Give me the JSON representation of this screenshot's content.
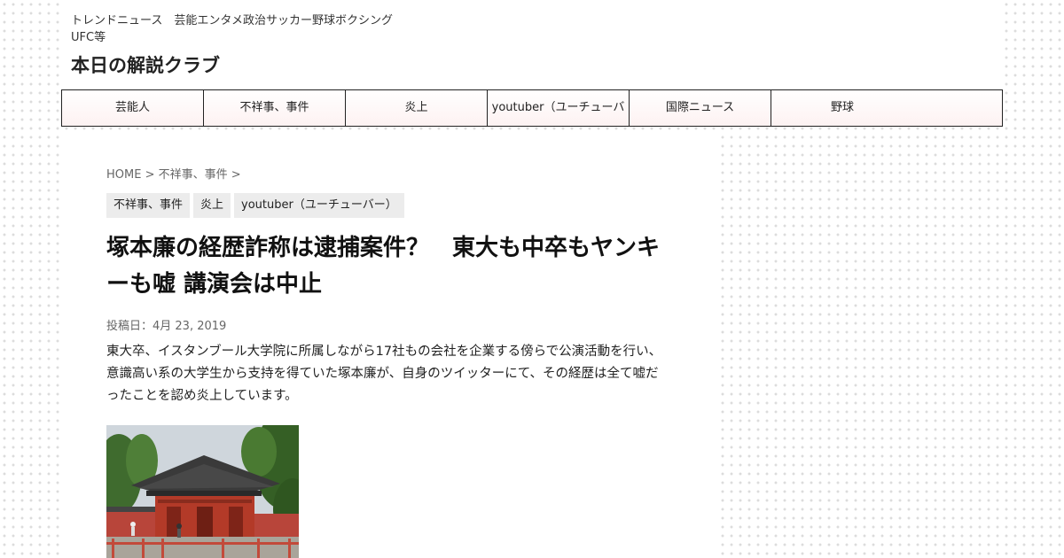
{
  "header": {
    "description": "トレンドニュース　芸能エンタメ政治サッカー野球ボクシングUFC等",
    "site_title": "本日の解説クラブ"
  },
  "nav": {
    "items": [
      {
        "label": "芸能人"
      },
      {
        "label": "不祥事、事件"
      },
      {
        "label": "炎上"
      },
      {
        "label": "youtuber（ユーチューバ"
      },
      {
        "label": "国際ニュース"
      },
      {
        "label": "野球"
      }
    ]
  },
  "breadcrumb": {
    "home": "HOME",
    "sep1": " > ",
    "category": "不祥事、事件",
    "sep2": " >"
  },
  "tags": [
    "不祥事、事件",
    "炎上",
    "youtuber（ユーチューバー）"
  ],
  "article": {
    "title": "塚本廉の経歴詐称は逮捕案件？　東大も中卒もヤンキーも嘘 講演会は中止",
    "date": "投稿日：4月 23, 2019",
    "excerpt": "東大卒、イスタンブール大学院に所属しながら17社もの会社を企業する傍らで公演活動を行い、意識高い系の大学生から支持を得ていた塚本廉が、自身のツイッターにて、その経歴は全て嘘だったことを認め炎上しています。"
  },
  "colors": {
    "nav_gradient_bottom": "#fdf2f2",
    "border": "#222222",
    "tag_bg": "#ececec",
    "meta_text": "#666666"
  }
}
